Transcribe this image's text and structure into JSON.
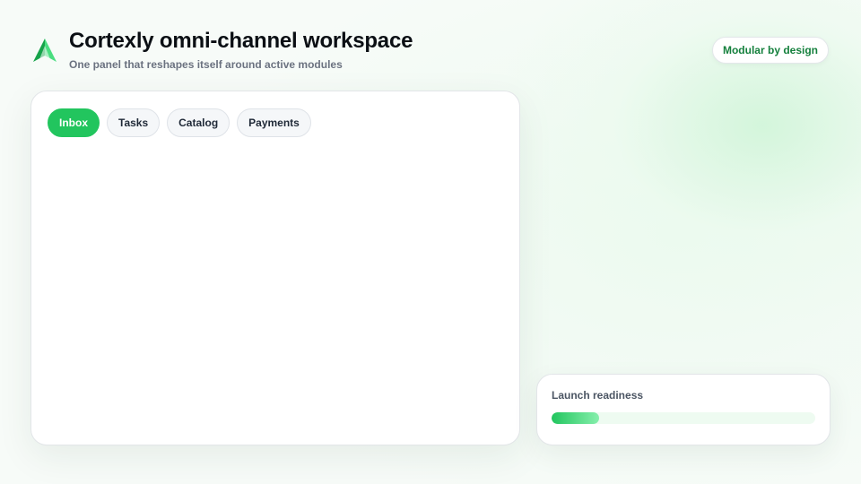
{
  "header": {
    "logo_icon": "leaf-triangle-logo",
    "title": "Cortexly omni-channel workspace",
    "subtitle": "One panel that reshapes itself around active modules",
    "badge_label": "Modular by design"
  },
  "main": {
    "tabs": [
      {
        "label": "Inbox",
        "active": true
      },
      {
        "label": "Tasks",
        "active": false
      },
      {
        "label": "Catalog",
        "active": false
      },
      {
        "label": "Payments",
        "active": false
      }
    ]
  },
  "readiness": {
    "label": "Launch readiness",
    "progress_fraction": 0.18
  },
  "colors": {
    "accent": "#22c55e",
    "accent_dark": "#15803d",
    "text_primary": "#0b0f14",
    "text_muted": "#6b7280"
  }
}
